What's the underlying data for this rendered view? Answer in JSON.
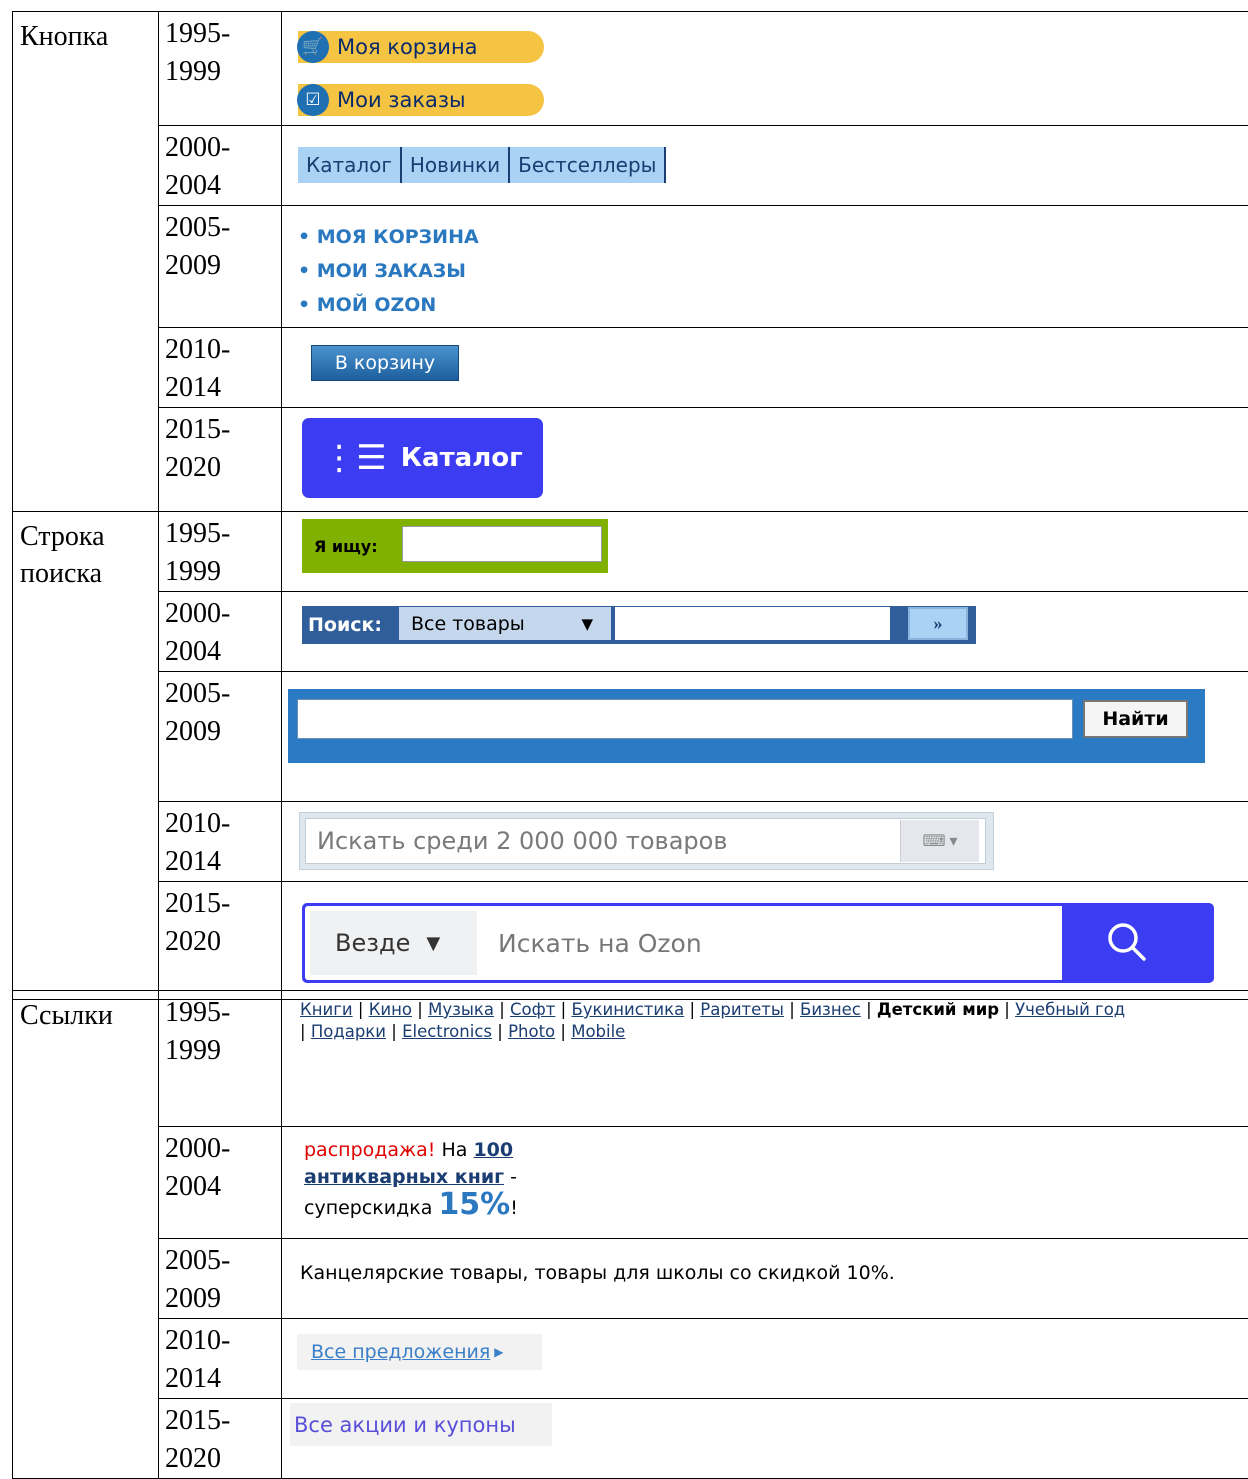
{
  "sections": {
    "button": "Кнопка",
    "search": "Строка поиска",
    "links": "Ссылки"
  },
  "years": {
    "y1": "1995-\n1999",
    "y2": "2000-\n2004",
    "y3": "2005-\n2009",
    "y4": "2010-\n2014",
    "y5": "2015-\n2020"
  },
  "buttons": {
    "b1995": {
      "cart": "Моя корзина",
      "orders": "Мои заказы"
    },
    "b2000": {
      "tabs": [
        "Каталог",
        "Новинки",
        "Бестселлеры"
      ]
    },
    "b2005": {
      "items": [
        "МОЯ КОРЗИНА",
        "МОИ ЗАКАЗЫ",
        "МОЙ OZON"
      ]
    },
    "b2010": {
      "label": "В корзину"
    },
    "b2015": {
      "label": "Каталог"
    }
  },
  "search": {
    "s1995": {
      "label": "Я ищу:"
    },
    "s2000": {
      "label": "Поиск:",
      "category": "Все товары",
      "go": "»"
    },
    "s2005": {
      "button": "Найти"
    },
    "s2010": {
      "placeholder": "Искать среди 2 000 000 товаров"
    },
    "s2015": {
      "scope": "Везде",
      "placeholder": "Искать на Ozon"
    }
  },
  "links": {
    "l1995": {
      "items": [
        "Книги",
        "Кино",
        "Музыка",
        "Софт",
        "Букинистика",
        "Раритеты",
        "Бизнес",
        "Детский мир",
        "Учебный год",
        "Подарки",
        "Electronics",
        "Photo",
        "Mobile"
      ]
    },
    "l2000": {
      "sale": "распродажа!",
      "on": "На",
      "link": "100 антикварных книг",
      "dash": "-",
      "discount": "суперскидка",
      "percent": "15%",
      "bang": "!"
    },
    "l2005": {
      "text": "Канцелярские товары, товары для школы со скидкой 10%."
    },
    "l2010": {
      "link": "Все предложения"
    },
    "l2015": {
      "link": "Все акции и купоны"
    }
  }
}
